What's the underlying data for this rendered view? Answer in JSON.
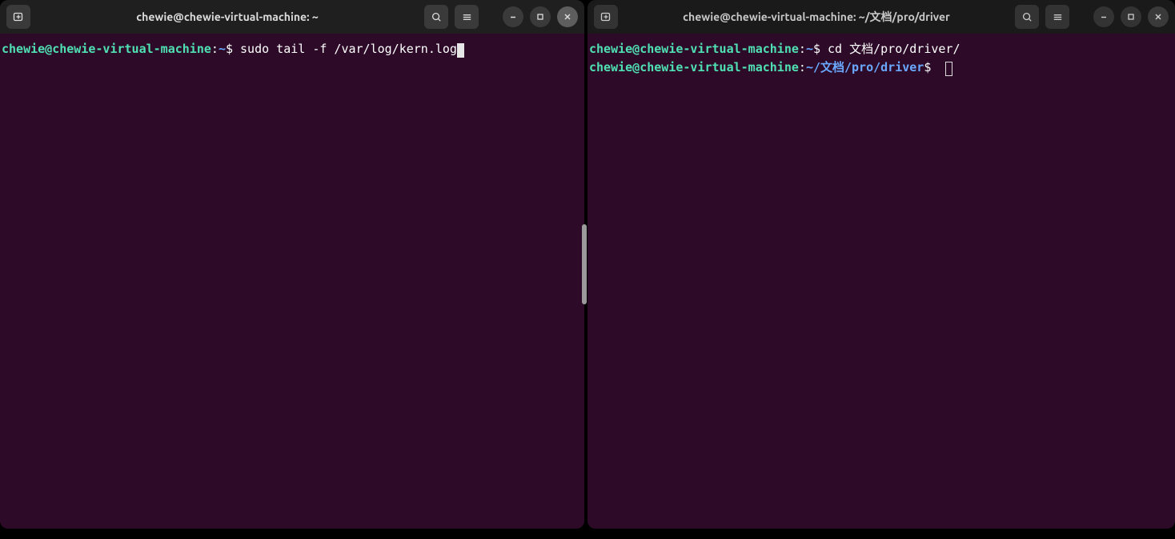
{
  "left": {
    "title": "chewie@chewie-virtual-machine: ~",
    "lines": [
      {
        "userhost": "chewie@chewie-virtual-machine",
        "path": "~",
        "prompt": "$",
        "cmd": "sudo tail -f /var/log/kern.log",
        "cursor": "block"
      }
    ]
  },
  "right": {
    "title": "chewie@chewie-virtual-machine: ~/文档/pro/driver",
    "lines": [
      {
        "userhost": "chewie@chewie-virtual-machine",
        "path": "~",
        "prompt": "$",
        "cmd": "cd 文档/pro/driver/",
        "cursor": "none"
      },
      {
        "userhost": "chewie@chewie-virtual-machine",
        "path": "~/文档/pro/driver",
        "prompt": "$",
        "cmd": "",
        "cursor": "outline"
      }
    ]
  },
  "icons": {
    "newtab": "new-tab-icon",
    "search": "search-icon",
    "menu": "hamburger-menu-icon",
    "min": "minimize-icon",
    "max": "maximize-icon",
    "close": "close-icon"
  }
}
